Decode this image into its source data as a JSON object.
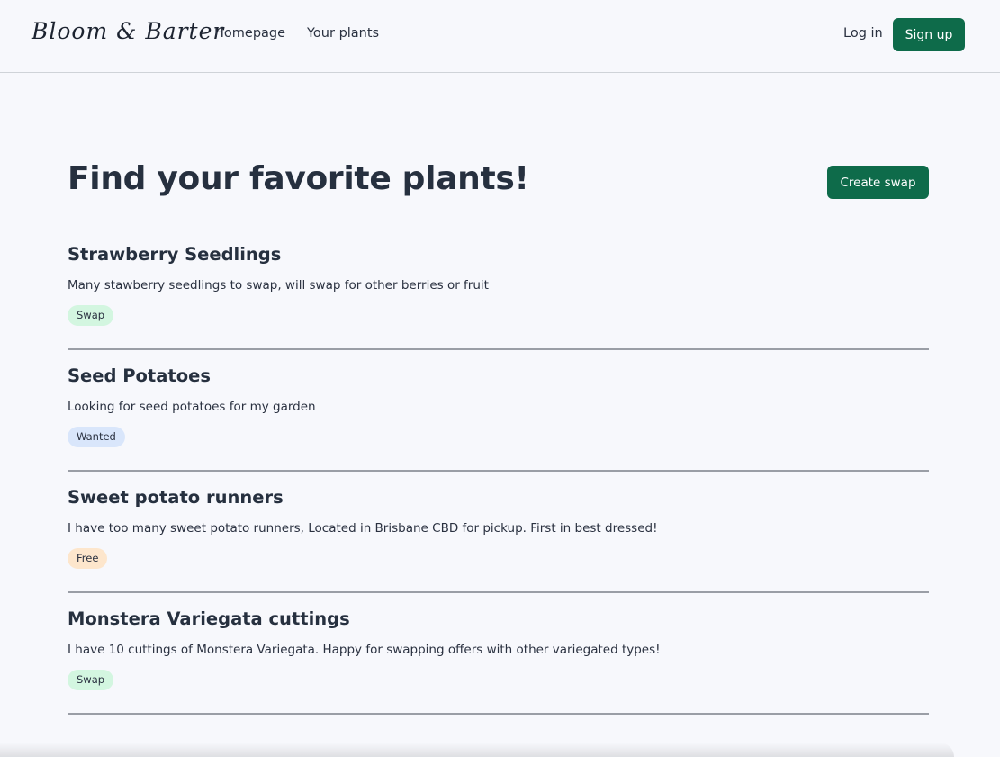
{
  "header": {
    "logo": "Bloom & Barter",
    "nav": {
      "homepage": "Homepage",
      "your_plants": "Your plants"
    },
    "login": "Log in",
    "signup": "Sign up"
  },
  "main": {
    "title": "Find your favorite plants!",
    "create_button": "Create swap",
    "listings": [
      {
        "title": "Strawberry Seedlings",
        "description": "Many stawberry seedlings to swap, will swap for other berries or fruit",
        "tag": "Swap"
      },
      {
        "title": "Seed Potatoes",
        "description": "Looking for seed potatoes for my garden",
        "tag": "Wanted"
      },
      {
        "title": "Sweet potato runners",
        "description": "I have too many sweet potato runners, Located in Brisbane CBD for pickup. First in best dressed!",
        "tag": "Free"
      },
      {
        "title": "Monstera Variegata cuttings",
        "description": "I have 10 cuttings of Monstera Variegata. Happy for swapping offers with other variegated types!",
        "tag": "Swap"
      }
    ]
  },
  "colors": {
    "brand_green": "#0e6b4a",
    "tag_swap": "#d3f6e0",
    "tag_wanted": "#d9e6fb",
    "tag_free": "#fde6cc",
    "background": "#f7f8fc"
  }
}
